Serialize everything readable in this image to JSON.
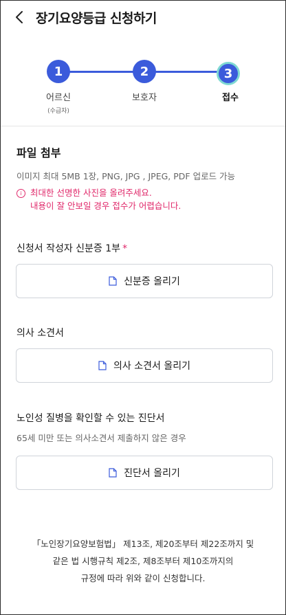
{
  "header": {
    "title": "장기요양등급 신청하기"
  },
  "steps": [
    {
      "number": "1",
      "label": "어르신",
      "sub": "(수급자)"
    },
    {
      "number": "2",
      "label": "보호자",
      "sub": ""
    },
    {
      "number": "3",
      "label": "접수",
      "sub": "",
      "active": true
    }
  ],
  "attach": {
    "title": "파일 첨부",
    "note": "이미지 최대 5MB 1장, PNG, JPG , JPEG, PDF 업로드 가능",
    "warn_line1": "최대한 선명한 사진을 올려주세요.",
    "warn_line2": "내용이 잘 안보일 경우 접수가 어렵습니다."
  },
  "sections": {
    "id": {
      "label": "신청서 작성자 신분증 1부",
      "required_mark": "*",
      "button": "신분증 올리기"
    },
    "opinion": {
      "label": "의사 소견서",
      "button": "의사 소견서 올리기"
    },
    "diagnosis": {
      "label": "노인성 질병을 확인할 수 있는 진단서",
      "note": "65세 미만 또는 의사소견서 제출하지 않은 경우",
      "button": "진단서 올리기"
    }
  },
  "footer": {
    "line1": "「노인장기요양보험법」 제13조, 제20조부터 제22조까지 및",
    "line2": "같은 법 시행규칙 제2조, 제8조부터 제10조까지의",
    "line3": "규정에 따라 위와 같이 신청합니다."
  },
  "colors": {
    "primary": "#3b5bdb",
    "warning": "#e0286a",
    "active_ring": "#7fd9d3"
  }
}
